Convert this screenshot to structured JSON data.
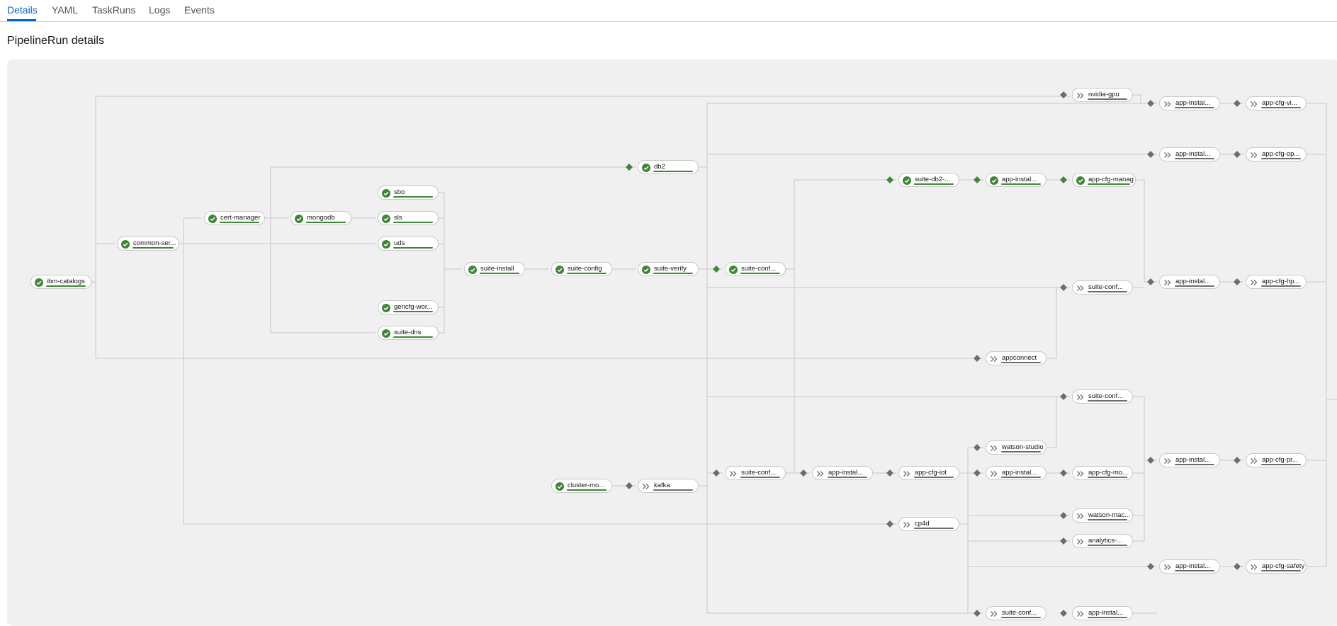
{
  "tabs": [
    {
      "label": "Details",
      "active": true
    },
    {
      "label": "YAML",
      "active": false
    },
    {
      "label": "TaskRuns",
      "active": false
    },
    {
      "label": "Logs",
      "active": false
    },
    {
      "label": "Events",
      "active": false
    }
  ],
  "page_title": "PipelineRun details",
  "colors": {
    "accent": "#0066cc",
    "succeeded": "#3e8635",
    "pending": "#6a6e73",
    "edge": "#c9c9c9",
    "canvas": "#f0f0f0"
  },
  "graph": {
    "nodes": [
      {
        "id": "ibm-catalogs",
        "label": "ibm-catalogs",
        "status": "succeeded"
      },
      {
        "id": "common-services",
        "label": "common-ser...",
        "status": "succeeded"
      },
      {
        "id": "cert-manager",
        "label": "cert-manager",
        "status": "succeeded"
      },
      {
        "id": "mongodb",
        "label": "mongodb",
        "status": "succeeded"
      },
      {
        "id": "sbo",
        "label": "sbo",
        "status": "succeeded"
      },
      {
        "id": "sls",
        "label": "sls",
        "status": "succeeded"
      },
      {
        "id": "uds",
        "label": "uds",
        "status": "succeeded"
      },
      {
        "id": "gencfg-workspace",
        "label": "gencfg-wor...",
        "status": "succeeded"
      },
      {
        "id": "suite-dns",
        "label": "suite-dns",
        "status": "succeeded"
      },
      {
        "id": "suite-install",
        "label": "suite-install",
        "status": "succeeded"
      },
      {
        "id": "suite-config",
        "label": "suite-config",
        "status": "succeeded"
      },
      {
        "id": "suite-verify",
        "label": "suite-verify",
        "status": "succeeded"
      },
      {
        "id": "db2",
        "label": "db2",
        "status": "succeeded"
      },
      {
        "id": "suite-config-1",
        "label": "suite-conf...",
        "status": "succeeded"
      },
      {
        "id": "suite-db2",
        "label": "suite-db2-...",
        "status": "succeeded"
      },
      {
        "id": "app-install-manage",
        "label": "app-instal...",
        "status": "succeeded"
      },
      {
        "id": "app-cfg-manage",
        "label": "app-cfg-manage",
        "status": "succeeded"
      },
      {
        "id": "cluster-monitoring",
        "label": "cluster-mo...",
        "status": "succeeded"
      },
      {
        "id": "kafka",
        "label": "kafka",
        "status": "pending"
      },
      {
        "id": "nvidia-gpu",
        "label": "nvidia-gpu",
        "status": "pending"
      },
      {
        "id": "app-install-visualinspection",
        "label": "app-instal...",
        "status": "pending"
      },
      {
        "id": "app-cfg-visualinspection",
        "label": "app-cfg-vi...",
        "status": "pending"
      },
      {
        "id": "app-install-optimizer",
        "label": "app-instal...",
        "status": "pending"
      },
      {
        "id": "app-cfg-optimizer",
        "label": "app-cfg-op...",
        "status": "pending"
      },
      {
        "id": "suite-config-2",
        "label": "suite-conf...",
        "status": "pending"
      },
      {
        "id": "app-install-hputilities",
        "label": "app-instal...",
        "status": "pending"
      },
      {
        "id": "app-cfg-hputilities",
        "label": "app-cfg-hp...",
        "status": "pending"
      },
      {
        "id": "appconnect",
        "label": "appconnect",
        "status": "pending"
      },
      {
        "id": "suite-config-3",
        "label": "suite-conf...",
        "status": "pending"
      },
      {
        "id": "watson-studio",
        "label": "watson-studio",
        "status": "pending"
      },
      {
        "id": "app-install-predict",
        "label": "app-instal...",
        "status": "pending"
      },
      {
        "id": "app-cfg-predict",
        "label": "app-cfg-pr...",
        "status": "pending"
      },
      {
        "id": "suite-config-iot",
        "label": "suite-conf...",
        "status": "pending"
      },
      {
        "id": "app-install-iot",
        "label": "app-instal...",
        "status": "pending"
      },
      {
        "id": "app-cfg-iot",
        "label": "app-cfg-iot",
        "status": "pending"
      },
      {
        "id": "app-install-monitor",
        "label": "app-instal...",
        "status": "pending"
      },
      {
        "id": "app-cfg-monitor",
        "label": "app-cfg-mo...",
        "status": "pending"
      },
      {
        "id": "cp4d",
        "label": "cp4d",
        "status": "pending"
      },
      {
        "id": "watson-machine-learning",
        "label": "watson-mac...",
        "status": "pending"
      },
      {
        "id": "analytics-engine",
        "label": "analytics-...",
        "status": "pending"
      },
      {
        "id": "app-install-safety",
        "label": "app-instal...",
        "status": "pending"
      },
      {
        "id": "app-cfg-safety",
        "label": "app-cfg-safety",
        "status": "pending"
      },
      {
        "id": "suite-config-4",
        "label": "suite-conf...",
        "status": "pending"
      },
      {
        "id": "app-install-assist",
        "label": "app-instal...",
        "status": "pending"
      }
    ]
  }
}
